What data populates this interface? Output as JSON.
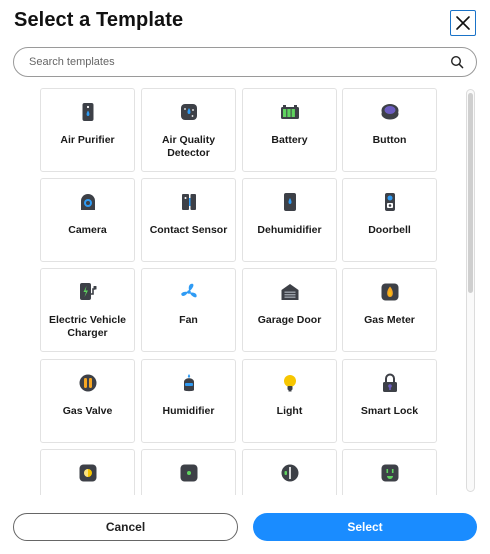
{
  "dialog": {
    "title": "Select a Template",
    "close_icon": "close-icon"
  },
  "search": {
    "placeholder": "Search templates",
    "value": "",
    "icon": "search-icon"
  },
  "templates": [
    {
      "label": "Air Purifier",
      "icon": "air-purifier-icon"
    },
    {
      "label": "Air Quality Detector",
      "icon": "air-quality-detector-icon"
    },
    {
      "label": "Battery",
      "icon": "battery-icon"
    },
    {
      "label": "Button",
      "icon": "button-icon"
    },
    {
      "label": "Camera",
      "icon": "camera-icon"
    },
    {
      "label": "Contact Sensor",
      "icon": "contact-sensor-icon"
    },
    {
      "label": "Dehumidifier",
      "icon": "dehumidifier-icon"
    },
    {
      "label": "Doorbell",
      "icon": "doorbell-icon"
    },
    {
      "label": "Electric Vehicle Charger",
      "icon": "ev-charger-icon"
    },
    {
      "label": "Fan",
      "icon": "fan-icon"
    },
    {
      "label": "Garage Door",
      "icon": "garage-door-icon"
    },
    {
      "label": "Gas Meter",
      "icon": "gas-meter-icon"
    },
    {
      "label": "Gas Valve",
      "icon": "gas-valve-icon"
    },
    {
      "label": "Humidifier",
      "icon": "humidifier-icon"
    },
    {
      "label": "Light",
      "icon": "light-icon"
    },
    {
      "label": "Smart Lock",
      "icon": "smart-lock-icon"
    },
    {
      "label": "",
      "icon": "dimmer-icon"
    },
    {
      "label": "",
      "icon": "switch-icon"
    },
    {
      "label": "",
      "icon": "blind-icon"
    },
    {
      "label": "",
      "icon": "outlet-icon"
    }
  ],
  "colors": {
    "icon_dark": "#3d4047",
    "icon_accent_blue": "#2f9bf4",
    "icon_accent_green": "#5fd35f",
    "icon_accent_yellow": "#f7c600",
    "icon_accent_orange": "#f5a623",
    "icon_accent_purple": "#6b5cc0",
    "primary_button": "#1a8cff"
  },
  "footer": {
    "cancel_label": "Cancel",
    "select_label": "Select"
  }
}
